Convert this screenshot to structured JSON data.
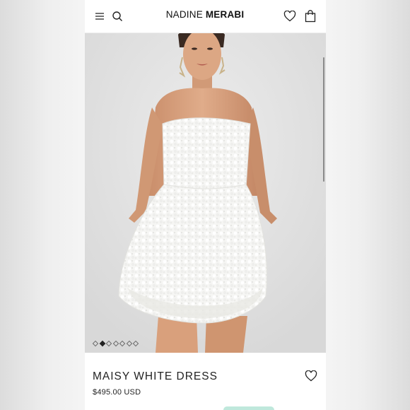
{
  "header": {
    "brand_light": "NADINE ",
    "brand_bold": "MERABI",
    "icons": [
      "menu-icon",
      "search-icon",
      "heart-icon",
      "bag-icon"
    ]
  },
  "carousel": {
    "image_alt": "Model wearing strapless white textured mini dress",
    "total_slides": 7,
    "active_slide": 2
  },
  "product": {
    "title": "MAISY WHITE DRESS",
    "price": "$495.00 USD"
  },
  "colors": {
    "dress": "#f7f7f5",
    "skin": "#d9a27f",
    "background": "#e4e4e4",
    "peek_button": "#bfe8dc"
  }
}
